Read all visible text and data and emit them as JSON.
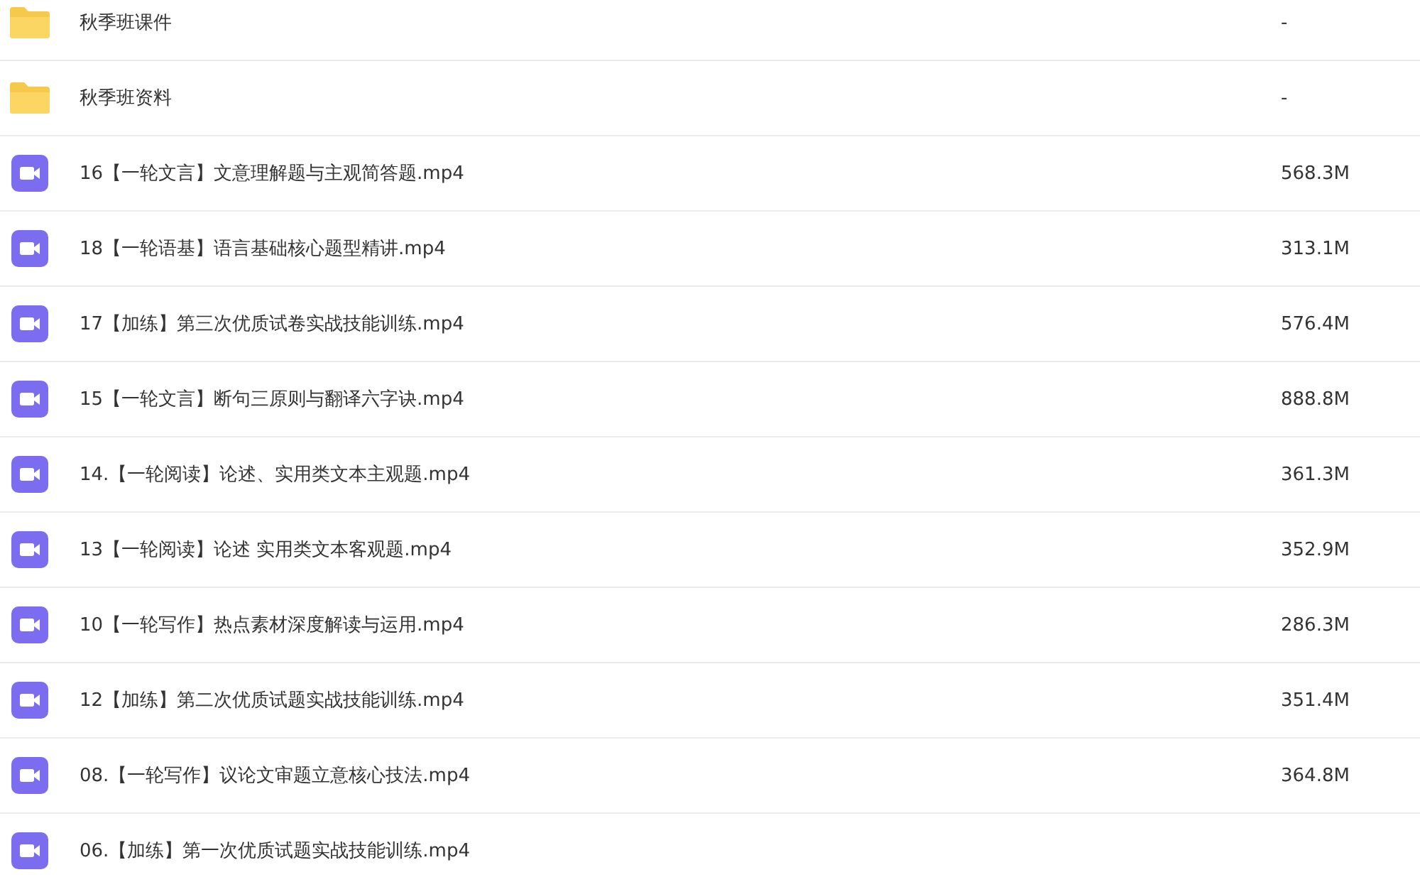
{
  "files": [
    {
      "kind": "folder",
      "name": "秋季班课件",
      "size": "-"
    },
    {
      "kind": "folder",
      "name": "秋季班资料",
      "size": "-"
    },
    {
      "kind": "video",
      "name": "16【一轮文言】文意理解题与主观简答题.mp4",
      "size": "568.3M"
    },
    {
      "kind": "video",
      "name": "18【一轮语基】语言基础核心题型精讲.mp4",
      "size": "313.1M"
    },
    {
      "kind": "video",
      "name": "17【加练】第三次优质试卷实战技能训练.mp4",
      "size": "576.4M"
    },
    {
      "kind": "video",
      "name": "15【一轮文言】断句三原则与翻译六字诀.mp4",
      "size": "888.8M"
    },
    {
      "kind": "video",
      "name": "14.【一轮阅读】论述、实用类文本主观题.mp4",
      "size": "361.3M"
    },
    {
      "kind": "video",
      "name": "13【一轮阅读】论述 实用类文本客观题.mp4",
      "size": "352.9M"
    },
    {
      "kind": "video",
      "name": "10【一轮写作】热点素材深度解读与运用.mp4",
      "size": "286.3M"
    },
    {
      "kind": "video",
      "name": "12【加练】第二次优质试题实战技能训练.mp4",
      "size": "351.4M"
    },
    {
      "kind": "video",
      "name": "08.【一轮写作】议论文审题立意核心技法.mp4",
      "size": "364.8M"
    },
    {
      "kind": "video",
      "name": "06.【加练】第一次优质试题实战技能训练.mp4"
    }
  ]
}
